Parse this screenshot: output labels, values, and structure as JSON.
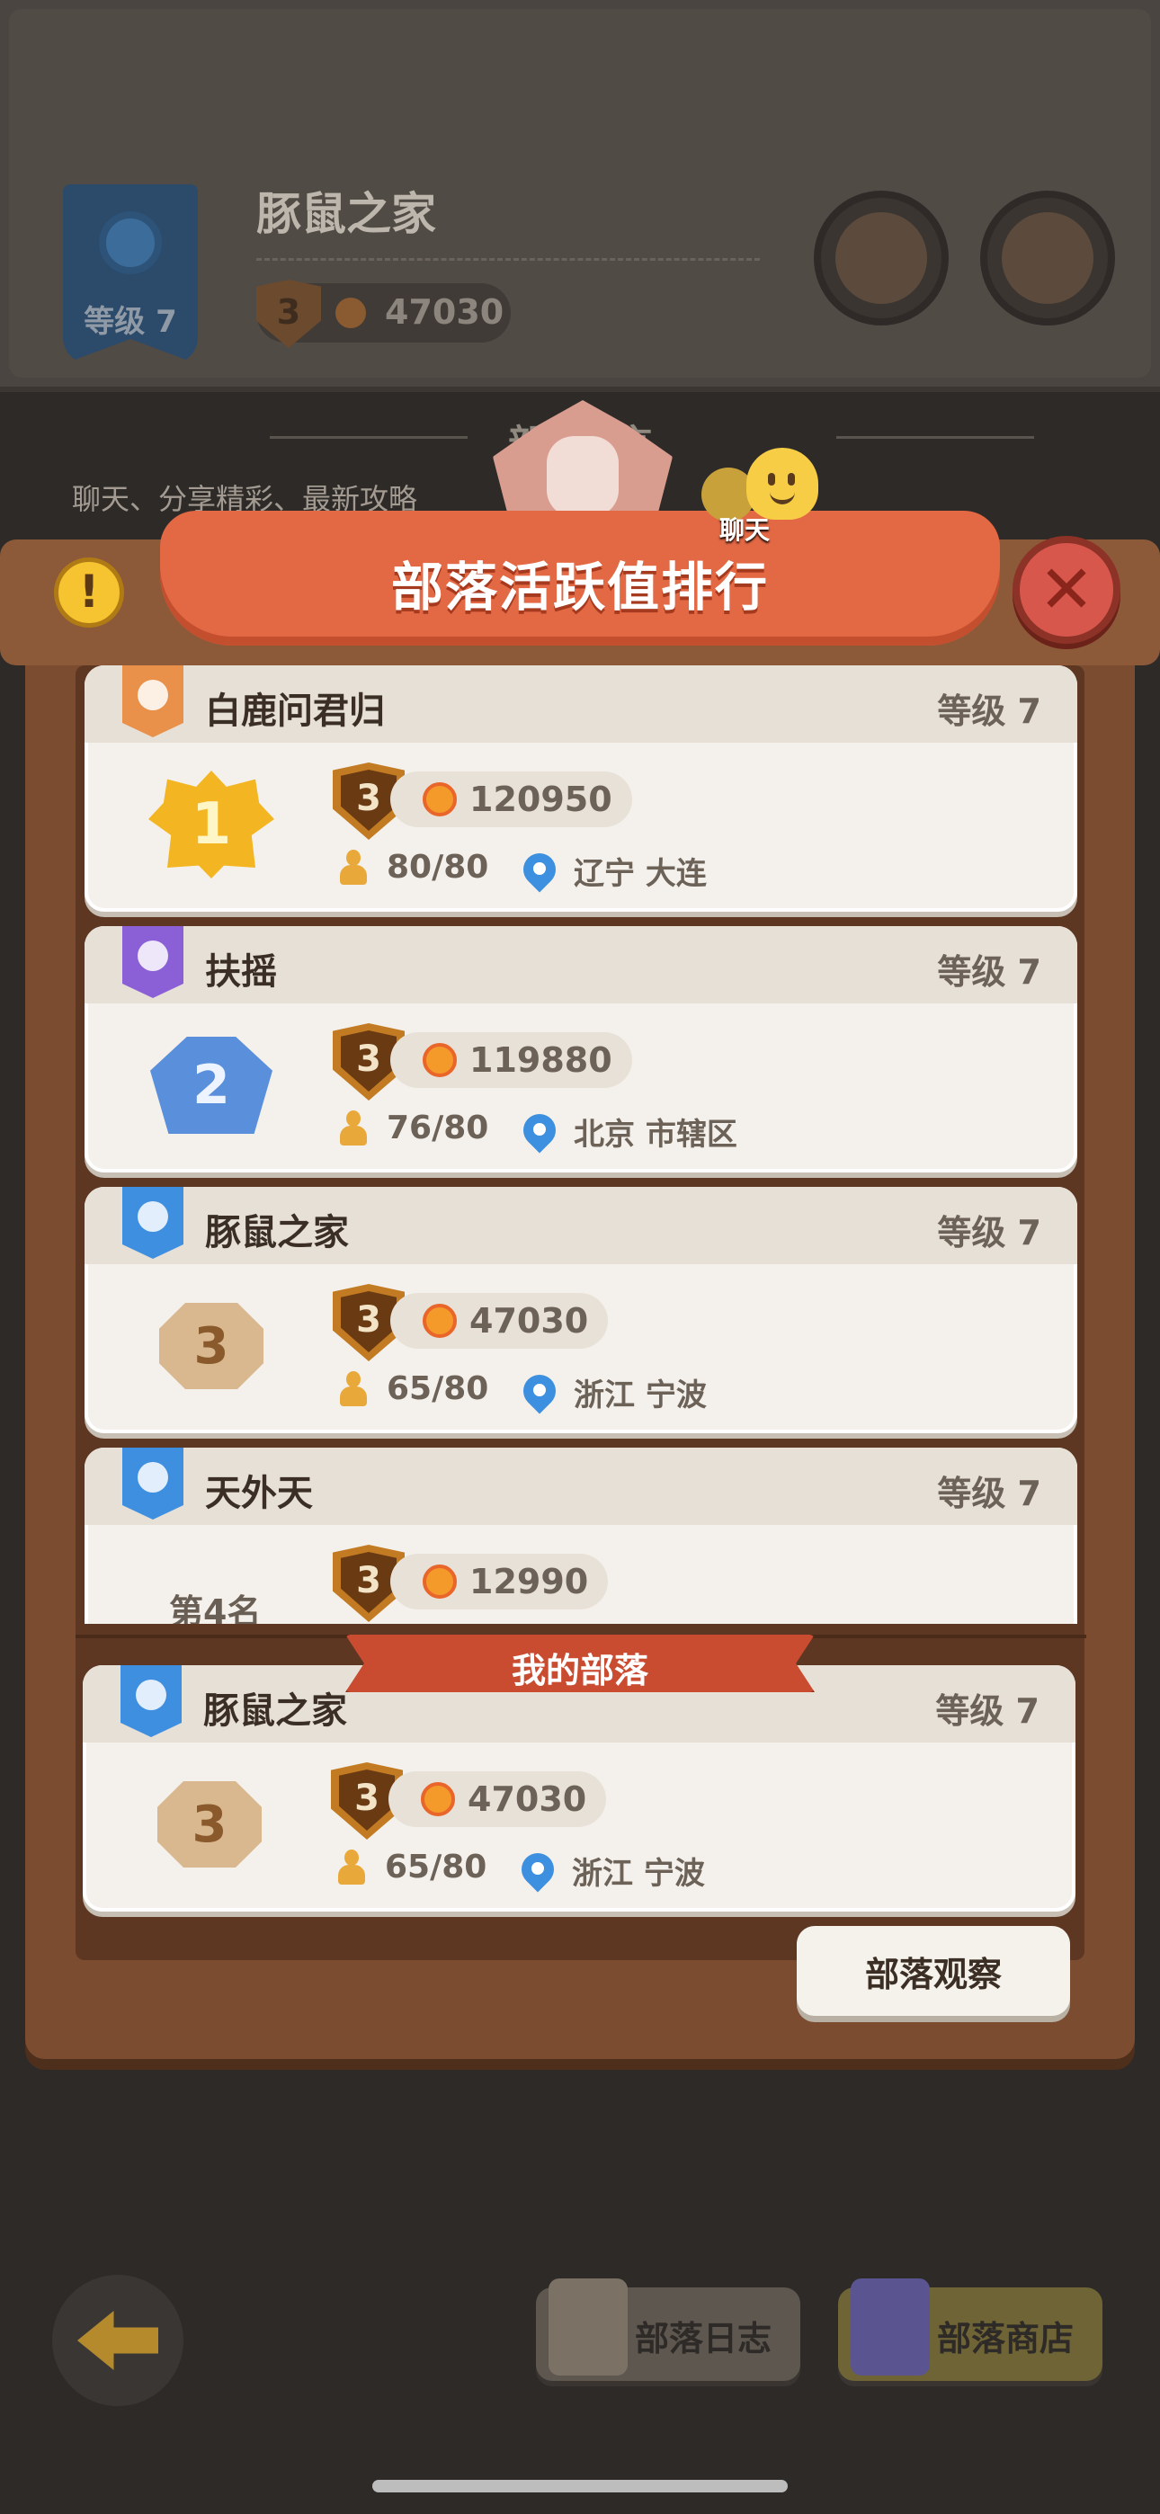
{
  "background": {
    "tribe_name": "豚鼠之家",
    "tribe_level": "等级 7",
    "tier": "3",
    "score": "47030",
    "section_title": "部落留言",
    "section_desc": "聊天、分享精彩、最新攻略"
  },
  "modal": {
    "title": "部落活跃值排行",
    "info_glyph": "!",
    "close_glyph": "✕",
    "chat_label": "聊天"
  },
  "ranking": [
    {
      "rank": "1",
      "name": "白鹿问君归",
      "level": "等级 7",
      "tier": "3",
      "score": "120950",
      "members": "80/80",
      "location": "辽宁 大连",
      "badge_color": "#e9914a",
      "medal": "gold"
    },
    {
      "rank": "2",
      "name": "扶摇",
      "level": "等级 7",
      "tier": "3",
      "score": "119880",
      "members": "76/80",
      "location": "北京 市辖区",
      "badge_color": "#8b5fd6",
      "medal": "blue"
    },
    {
      "rank": "3",
      "name": "豚鼠之家",
      "level": "等级 7",
      "tier": "3",
      "score": "47030",
      "members": "65/80",
      "location": "浙江 宁波",
      "badge_color": "#3f8fe0",
      "medal": "bronze"
    },
    {
      "rank_text": "第4名",
      "name": "天外天",
      "level": "等级 7",
      "tier": "3",
      "score": "12990",
      "badge_color": "#3f8fe0"
    }
  ],
  "my_tribe": {
    "label": "我的部落",
    "rank": "3",
    "name": "豚鼠之家",
    "level": "等级 7",
    "tier": "3",
    "score": "47030",
    "members": "65/80",
    "location": "浙江 宁波",
    "badge_color": "#3f8fe0"
  },
  "buttons": {
    "observe": "部落观察",
    "log": "部落日志",
    "shop": "部落商店"
  },
  "colors": {
    "ribbon": "#e36844",
    "frame": "#7b4c2f",
    "card": "#f4f1ec"
  }
}
